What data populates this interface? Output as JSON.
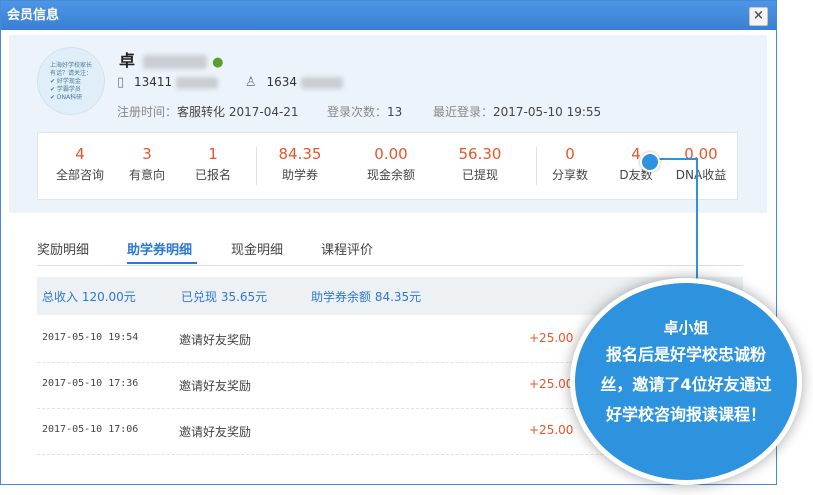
{
  "window": {
    "title": "会员信息",
    "close_label": "×"
  },
  "profile": {
    "name": "卓",
    "phone_prefix": "13411",
    "qq_prefix": "1634",
    "register": {
      "label": "注册时间：",
      "value": "客服转化 2017-04-21"
    },
    "login_count": {
      "label": "登录次数：",
      "value": "13"
    },
    "last_login": {
      "label": "最近登录：",
      "value": "2017-05-10 19:55"
    },
    "avatar_lines": [
      "上海好学校家长",
      "有话？请关注：",
      "✔ 好学现金",
      "✔ 学霸学员",
      "✔ DNA科研"
    ]
  },
  "stats": [
    {
      "value": "4",
      "label": "全部咨询"
    },
    {
      "value": "3",
      "label": "有意向"
    },
    {
      "value": "1",
      "label": "已报名"
    },
    {
      "value": "84.35",
      "label": "助学券"
    },
    {
      "value": "0.00",
      "label": "现金余额"
    },
    {
      "value": "56.30",
      "label": "已提现"
    },
    {
      "value": "0",
      "label": "分享数"
    },
    {
      "value": "4",
      "label": "D友数"
    },
    {
      "value": "0.00",
      "label": "DNA收益"
    }
  ],
  "tabs": [
    {
      "label": "奖励明细"
    },
    {
      "label": "助学券明细"
    },
    {
      "label": "现金明细"
    },
    {
      "label": "课程评价"
    }
  ],
  "summary": {
    "total": "总收入 120.00元",
    "redeemed": "已兑现 35.65元",
    "balance": "助学券余额 84.35元"
  },
  "rows": [
    {
      "date": "2017-05-10 19:54",
      "title": "邀请好友奖励",
      "amount": "+25.00"
    },
    {
      "date": "2017-05-10 17:36",
      "title": "邀请好友奖励",
      "amount": "+25.00"
    },
    {
      "date": "2017-05-10 17:06",
      "title": "邀请好友奖励",
      "amount": "+25.00"
    }
  ],
  "callout": {
    "name": "卓小姐",
    "lines": [
      "报名后是好学校忠诚粉",
      "丝，邀请了4位好友通过",
      "好学校咨询报读课程！"
    ]
  },
  "colors": {
    "accent": "#2b78d4",
    "amount": "#e8562a",
    "bubble": "#2e93de"
  }
}
